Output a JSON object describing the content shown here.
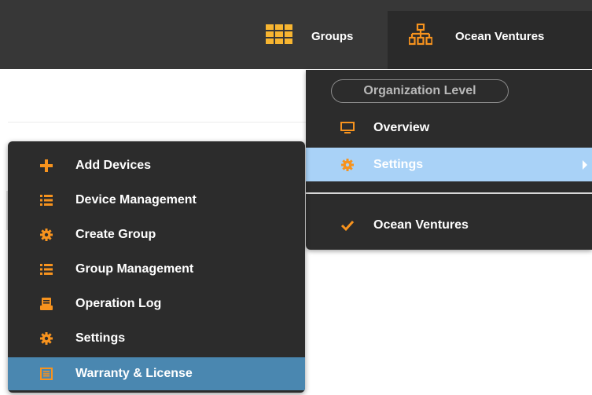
{
  "topbar": {
    "groups_label": "Groups",
    "org_label": "Ocean Ventures",
    "icons": {
      "groups": "grid-icon",
      "org": "org-chart-icon"
    }
  },
  "org_menu": {
    "section_label": "Organization Level",
    "items": [
      {
        "label": "Overview",
        "icon": "monitor-icon"
      },
      {
        "label": "Settings",
        "icon": "gear-icon",
        "highlighted": true,
        "has_submenu": true
      }
    ],
    "orgs": [
      {
        "label": "Ocean Ventures",
        "icon": "checkmark-icon",
        "selected": true
      }
    ]
  },
  "settings_menu": {
    "items": [
      {
        "label": "Add Devices",
        "icon": "plus-icon"
      },
      {
        "label": "Device Management",
        "icon": "list-icon"
      },
      {
        "label": "Create Group",
        "icon": "gear-icon"
      },
      {
        "label": "Group Management",
        "icon": "list-icon"
      },
      {
        "label": "Operation Log",
        "icon": "log-icon"
      },
      {
        "label": "Settings",
        "icon": "gear-icon"
      },
      {
        "label": "Warranty & License",
        "icon": "document-icon",
        "active": true
      }
    ]
  },
  "colors": {
    "accent_orange": "#f7931e",
    "topbar_bg": "#373737",
    "menu_bg": "#2c2c2c",
    "hover_blue": "#a9d2f7",
    "active_blue": "#4a87b0"
  }
}
